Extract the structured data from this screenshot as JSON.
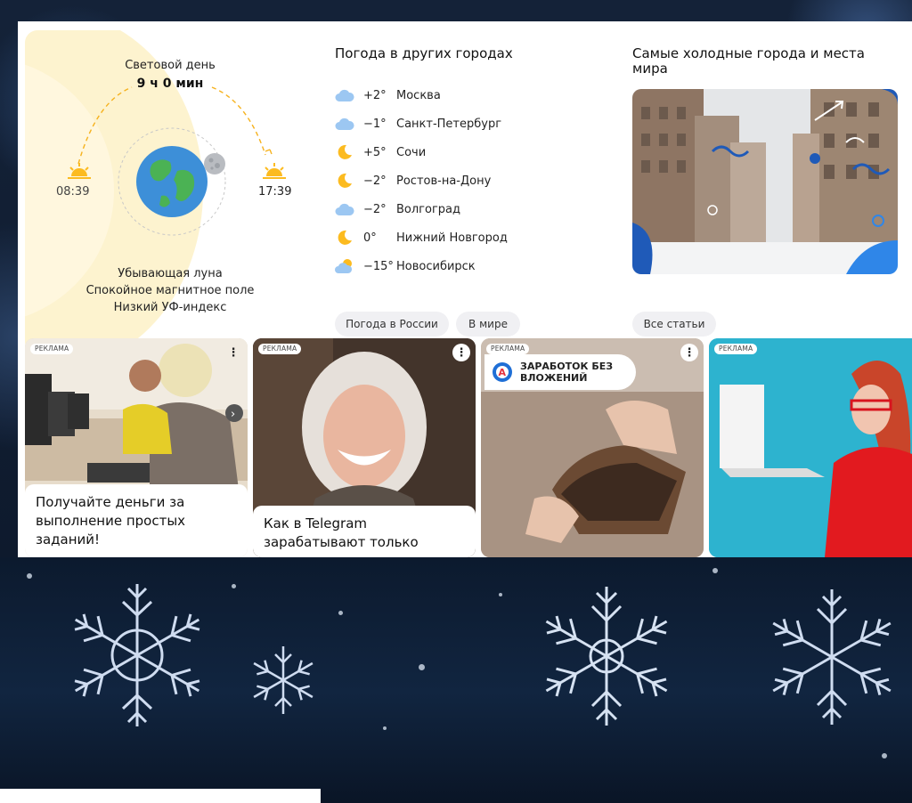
{
  "daylight": {
    "title": "Световой день",
    "length": "9 ч 0 мин",
    "sunrise": "08:39",
    "sunset": "17:39",
    "notes": [
      "Убывающая луна",
      "Спокойное магнитное поле",
      "Низкий УФ-индекс"
    ]
  },
  "cities": {
    "title": "Погода в других городах",
    "items": [
      {
        "icon": "cloud-icon",
        "temp": "+2°",
        "name": "Москва"
      },
      {
        "icon": "cloud-icon",
        "temp": "−1°",
        "name": "Санкт-Петербург"
      },
      {
        "icon": "moon-icon",
        "temp": "+5°",
        "name": "Сочи"
      },
      {
        "icon": "moon-icon",
        "temp": "−2°",
        "name": "Ростов-на-Дону"
      },
      {
        "icon": "cloud-icon",
        "temp": "−2°",
        "name": "Волгоград"
      },
      {
        "icon": "moon-icon",
        "temp": "0°",
        "name": "Нижний Новгород"
      },
      {
        "icon": "sun-cloud-icon",
        "temp": "−15°",
        "name": "Новосибирск"
      }
    ],
    "buttons": [
      "Погода в России",
      "В мире"
    ]
  },
  "coldest": {
    "title": "Самые холодные города и места мира",
    "button": "Все статьи"
  },
  "ads": {
    "badge": "РЕКЛАМА",
    "items": [
      {
        "text": "Получайте деньги за выполнение простых заданий!"
      },
      {
        "text": "Как в Telegram зарабатывают только"
      },
      {
        "banner": "ЗАРАБОТОК БЕЗ ВЛОЖЕНИЙ"
      },
      {}
    ]
  },
  "colors": {
    "accent_yellow": "#fcbb20",
    "cloud_blue": "#9cc7f2",
    "pill_bg": "#f0f0f3"
  }
}
